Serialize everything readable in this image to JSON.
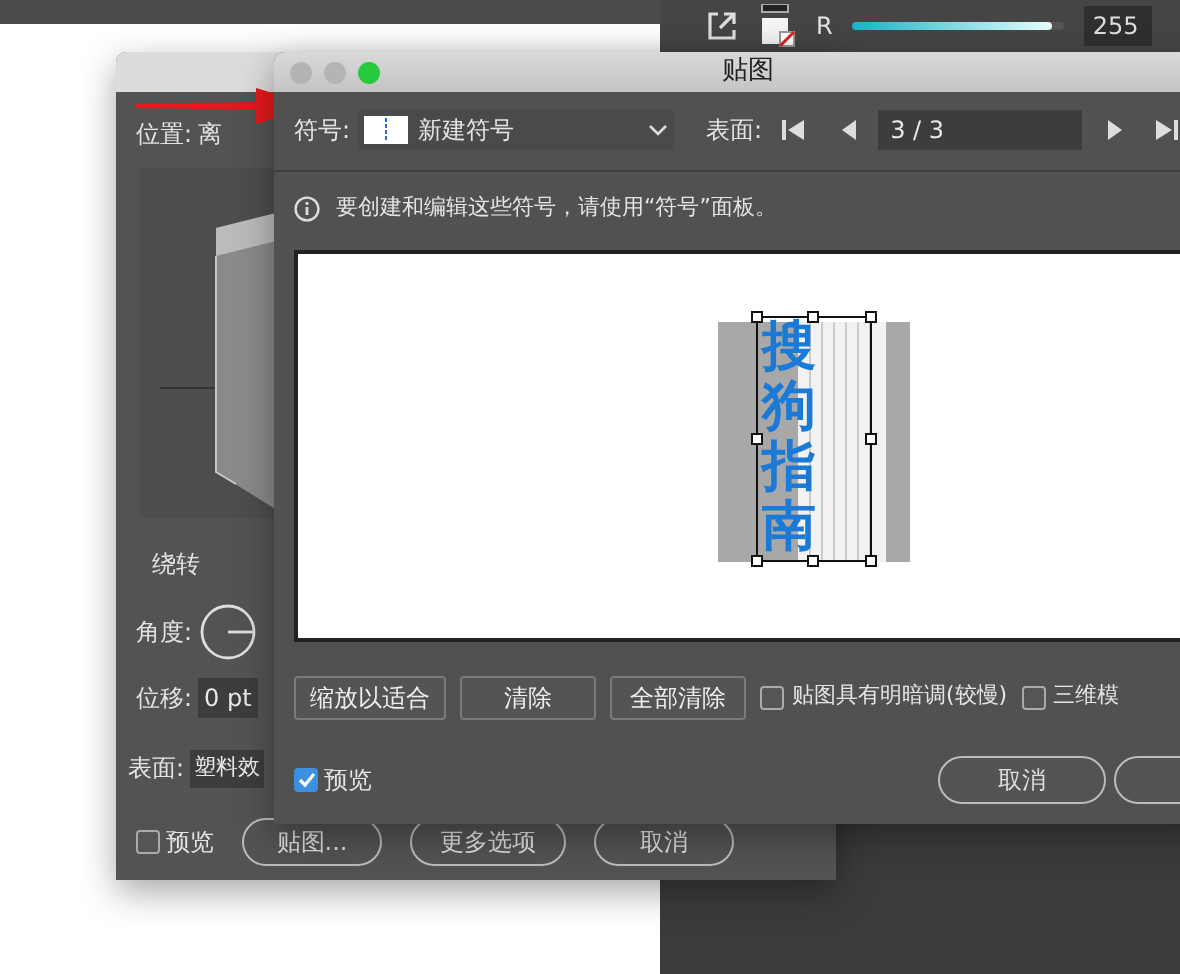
{
  "top_panel": {
    "slider_label": "R",
    "level": 0.94,
    "value": "255"
  },
  "back_dialog": {
    "position_label": "位置:",
    "position_value": "离",
    "rotate_heading": "绕转",
    "angle_label": "角度:",
    "offset_label": "位移:",
    "offset_value": "0 pt",
    "surface_label": "表面:",
    "surface_value": "塑料效",
    "preview": {
      "label": "预览",
      "checked": false
    },
    "buttons": [
      "贴图...",
      "更多选项",
      "取消"
    ]
  },
  "dialog": {
    "title": "贴图",
    "symbol_label": "符号:",
    "symbol_value": "新建符号",
    "surface_label": "表面:",
    "page_value": "3 / 3",
    "info": "要创建和编辑这些符号，请使用“符号”面板。",
    "art_text": "搜狗指南",
    "buttons": [
      "缩放以适合",
      "清除",
      "全部清除"
    ],
    "options": [
      {
        "label": "贴图具有明暗调(较慢)",
        "checked": false
      },
      {
        "label": "三维模",
        "checked": false
      }
    ],
    "preview": {
      "label": "预览",
      "checked": true
    },
    "footer_buttons": [
      "取消"
    ]
  }
}
